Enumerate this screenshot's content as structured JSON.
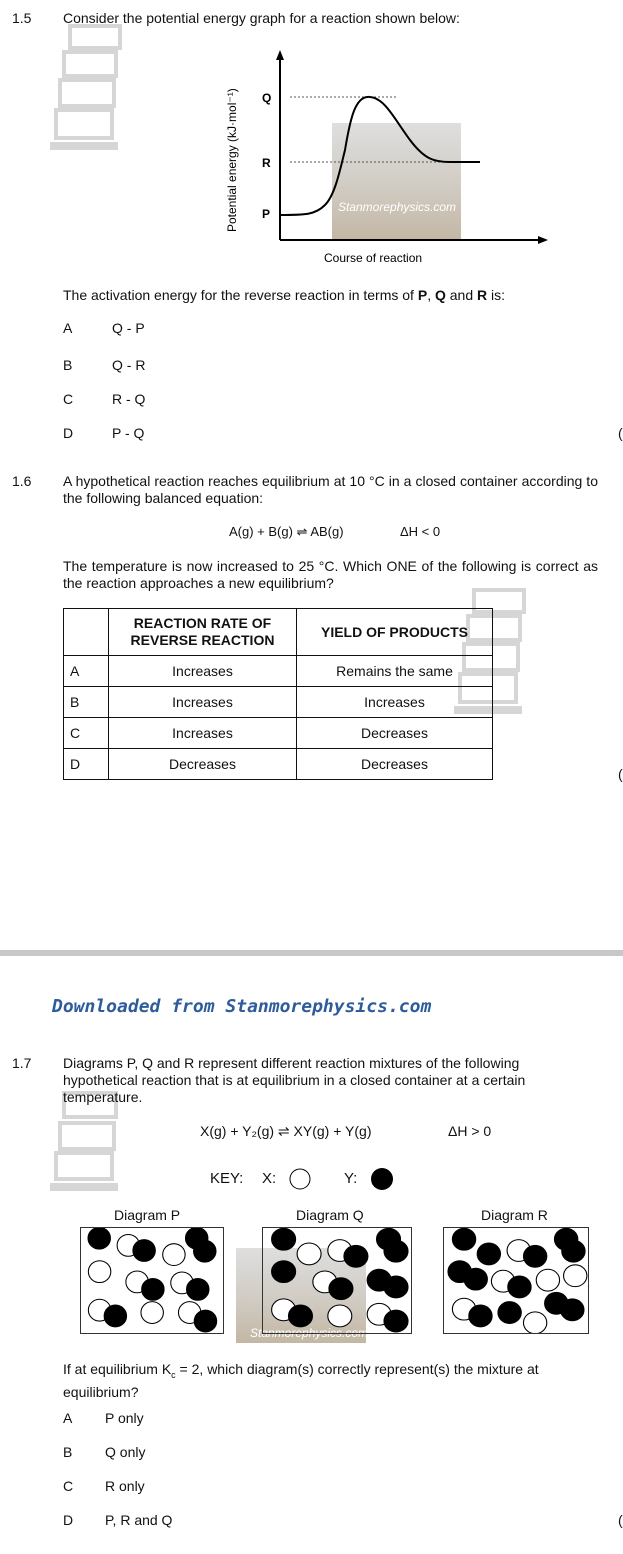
{
  "q15": {
    "number": "1.5",
    "stem": "Consider the potential energy graph for a reaction shown below:",
    "graph": {
      "ylabel": "Potential energy (kJ·mol⁻¹)",
      "xlabel": "Course of reaction",
      "levels": [
        "Q",
        "R",
        "P"
      ]
    },
    "question": "The activation energy for the reverse reaction in terms of P, Q and R is:",
    "question_parts": [
      "The activation energy for the reverse reaction in terms of ",
      "P",
      ", ",
      "Q",
      " and ",
      "R",
      " is:"
    ],
    "options": [
      {
        "letter": "A",
        "text": "Q - P"
      },
      {
        "letter": "B",
        "text": "Q - R"
      },
      {
        "letter": "C",
        "text": "R - Q"
      },
      {
        "letter": "D",
        "text": "P - Q"
      }
    ]
  },
  "q16": {
    "number": "1.6",
    "stem": "A hypothetical reaction reaches equilibrium at 10 °C in a closed container according to the following balanced equation:",
    "equation": "A(g) + B(g) ⇌ AB(g)",
    "enthalpy": "ΔH < 0",
    "question": "The temperature is now increased to 25 °C. Which ONE of the following is correct as the reaction approaches a new equilibrium?",
    "table": {
      "headers": [
        "",
        "REACTION RATE OF REVERSE REACTION",
        "YIELD OF PRODUCTS"
      ],
      "rows": [
        [
          "A",
          "Increases",
          "Remains the same"
        ],
        [
          "B",
          "Increases",
          "Increases"
        ],
        [
          "C",
          "Increases",
          "Decreases"
        ],
        [
          "D",
          "Decreases",
          "Decreases"
        ]
      ]
    }
  },
  "banner": "Downloaded from Stanmorephysics.com",
  "watermark": "Stanmorephysics.com",
  "q17": {
    "number": "1.7",
    "stem": "Diagrams P, Q and R represent different reaction mixtures of the following hypothetical reaction that is at equilibrium in a closed container at a certain temperature.",
    "equation": "X(g) + Y₂(g) ⇌ XY(g) + Y(g)",
    "enthalpy": "ΔH > 0",
    "key": {
      "label": "KEY:",
      "x": "X:",
      "y": "Y:"
    },
    "diagrams": [
      "Diagram P",
      "Diagram Q",
      "Diagram R"
    ],
    "question": "If at equilibrium Kc = 2, which diagram(s) correctly represent(s) the mixture at equilibrium?",
    "question_pre": "If at equilibrium K",
    "question_sub": "c",
    "question_post": " = 2, which diagram(s) correctly represent(s) the mixture at equilibrium?",
    "options": [
      {
        "letter": "A",
        "text": "P only"
      },
      {
        "letter": "B",
        "text": "Q only"
      },
      {
        "letter": "C",
        "text": "R only"
      },
      {
        "letter": "D",
        "text": "P, R and Q"
      }
    ]
  },
  "answer_bracket": "("
}
